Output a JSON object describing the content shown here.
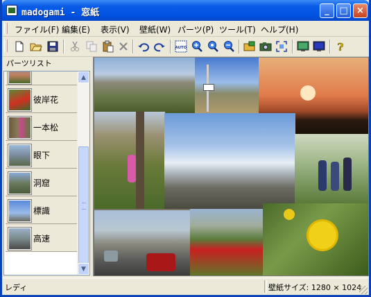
{
  "window": {
    "title": "madogami - 窓紙"
  },
  "menu": [
    "ファイル(F)",
    "編集(E)",
    "表示(V)",
    "壁紙(W)",
    "パーツ(P)",
    "ツール(T)",
    "ヘルプ(H)"
  ],
  "panel": {
    "title": "パーツリスト",
    "items": [
      {
        "label": ""
      },
      {
        "label": "彼岸花"
      },
      {
        "label": "一本松"
      },
      {
        "label": "眼下"
      },
      {
        "label": "洞窟"
      },
      {
        "label": "標識"
      },
      {
        "label": "高速"
      }
    ]
  },
  "toolbar": {
    "icons": [
      "new-icon",
      "open-icon",
      "save-icon",
      "cut-icon",
      "copy-icon",
      "paste-icon",
      "delete-icon",
      "undo-icon",
      "redo-icon",
      "auto-icon",
      "zoom-in-icon",
      "zoom-fit-icon",
      "zoom-out-icon",
      "open-image-icon",
      "camera-icon",
      "capture-icon",
      "wallpaper-icon",
      "screen-icon",
      "help-icon"
    ],
    "auto_label": "AUTO"
  },
  "status": {
    "left": "レディ",
    "right": "壁紙サイズ: 1280 × 1024"
  },
  "colors": {
    "titlebar": "#0054E3",
    "frame": "#0842B8",
    "face": "#ECE9D8"
  }
}
